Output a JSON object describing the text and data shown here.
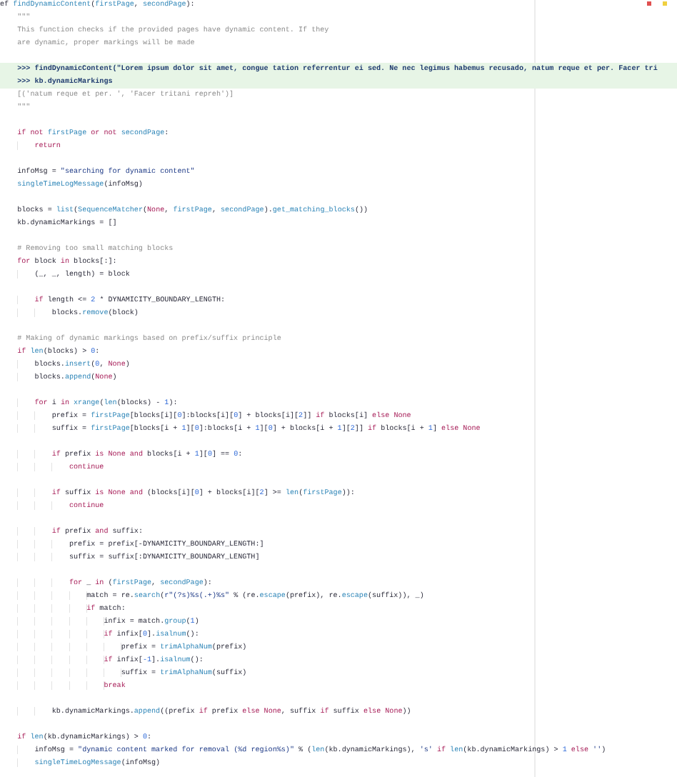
{
  "editor": {
    "blocks": [
      {
        "lines": [
          {
            "highlighted": false,
            "tokens": [
              {
                "kind": "plain",
                "text": "ef "
              },
              {
                "kind": "call",
                "text": "findDynamicContent"
              },
              {
                "kind": "plain",
                "text": "("
              },
              {
                "kind": "param",
                "text": "firstPage"
              },
              {
                "kind": "plain",
                "text": ", "
              },
              {
                "kind": "param",
                "text": "secondPage"
              },
              {
                "kind": "plain",
                "text": "):"
              }
            ]
          },
          {
            "highlighted": false,
            "tokens": [
              {
                "kind": "doc",
                "text": "    \"\"\""
              }
            ]
          },
          {
            "highlighted": false,
            "tokens": [
              {
                "kind": "doc",
                "text": "    This function checks if the provided pages have dynamic content. If they"
              }
            ]
          },
          {
            "highlighted": false,
            "tokens": [
              {
                "kind": "doc",
                "text": "    are dynamic, proper markings will be made"
              }
            ]
          }
        ]
      },
      {
        "lines": [
          {
            "highlighted": true,
            "tokens": [
              {
                "kind": "doctest",
                "text": "    >>> findDynamicContent(\"Lorem ipsum dolor sit amet, congue tation referrentur ei sed. Ne nec legimus habemus recusado, natum reque et per. Facer tri"
              }
            ]
          },
          {
            "highlighted": true,
            "tokens": [
              {
                "kind": "doctest",
                "text": "    >>> kb.dynamicMarkings"
              }
            ]
          },
          {
            "highlighted": false,
            "tokens": [
              {
                "kind": "doc",
                "text": "    [('natum reque et per. ', 'Facer tritani repreh')]"
              }
            ]
          },
          {
            "highlighted": false,
            "tokens": [
              {
                "kind": "doc",
                "text": "    \"\"\""
              }
            ]
          }
        ]
      },
      {
        "lines": [
          {
            "highlighted": false,
            "tokens": [
              {
                "kind": "keyword",
                "text": "    if"
              },
              {
                "kind": "keyword",
                "text": " not"
              },
              {
                "kind": "param",
                "text": " firstPage"
              },
              {
                "kind": "keyword",
                "text": " or"
              },
              {
                "kind": "keyword",
                "text": " not"
              },
              {
                "kind": "param",
                "text": " secondPage"
              },
              {
                "kind": "plain",
                "text": ":"
              }
            ]
          },
          {
            "highlighted": false,
            "tokens": [
              {
                "kind": "keyword",
                "text": "        return"
              }
            ]
          }
        ]
      },
      {
        "lines": [
          {
            "highlighted": false,
            "tokens": [
              {
                "kind": "plain",
                "text": "    infoMsg = "
              },
              {
                "kind": "string",
                "text": "\"searching for dynamic content\""
              }
            ]
          },
          {
            "highlighted": false,
            "tokens": [
              {
                "kind": "call",
                "text": "    singleTimeLogMessage"
              },
              {
                "kind": "plain",
                "text": "(infoMsg)"
              }
            ]
          }
        ]
      },
      {
        "lines": [
          {
            "highlighted": false,
            "tokens": [
              {
                "kind": "plain",
                "text": "    blocks = "
              },
              {
                "kind": "call",
                "text": "list"
              },
              {
                "kind": "plain",
                "text": "("
              },
              {
                "kind": "call",
                "text": "SequenceMatcher"
              },
              {
                "kind": "plain",
                "text": "("
              },
              {
                "kind": "constant",
                "text": "None"
              },
              {
                "kind": "plain",
                "text": ", "
              },
              {
                "kind": "param",
                "text": "firstPage"
              },
              {
                "kind": "plain",
                "text": ", "
              },
              {
                "kind": "param",
                "text": "secondPage"
              },
              {
                "kind": "plain",
                "text": ")."
              },
              {
                "kind": "call",
                "text": "get_matching_blocks"
              },
              {
                "kind": "plain",
                "text": "())"
              }
            ]
          },
          {
            "highlighted": false,
            "tokens": [
              {
                "kind": "plain",
                "text": "    kb.dynamicMarkings = []"
              }
            ]
          }
        ]
      },
      {
        "lines": [
          {
            "highlighted": false,
            "tokens": [
              {
                "kind": "comment",
                "text": "    # Removing too small matching blocks"
              }
            ]
          },
          {
            "highlighted": false,
            "tokens": [
              {
                "kind": "keyword",
                "text": "    for"
              },
              {
                "kind": "plain",
                "text": " block "
              },
              {
                "kind": "keyword",
                "text": "in"
              },
              {
                "kind": "plain",
                "text": " blocks[:]:"
              }
            ]
          },
          {
            "highlighted": false,
            "tokens": [
              {
                "kind": "plain",
                "text": "        (_, _, length) = block"
              }
            ]
          }
        ]
      },
      {
        "lines": [
          {
            "highlighted": false,
            "tokens": [
              {
                "kind": "keyword",
                "text": "        if"
              },
              {
                "kind": "plain",
                "text": " length <= "
              },
              {
                "kind": "number",
                "text": "2"
              },
              {
                "kind": "plain",
                "text": " * DYNAMICITY_BOUNDARY_LENGTH:"
              }
            ]
          },
          {
            "highlighted": false,
            "tokens": [
              {
                "kind": "plain",
                "text": "            blocks."
              },
              {
                "kind": "call",
                "text": "remove"
              },
              {
                "kind": "plain",
                "text": "(block)"
              }
            ]
          }
        ]
      },
      {
        "lines": [
          {
            "highlighted": false,
            "tokens": [
              {
                "kind": "comment",
                "text": "    # Making of dynamic markings based on prefix/suffix principle"
              }
            ]
          },
          {
            "highlighted": false,
            "tokens": [
              {
                "kind": "keyword",
                "text": "    if"
              },
              {
                "kind": "call",
                "text": " len"
              },
              {
                "kind": "plain",
                "text": "(blocks) > "
              },
              {
                "kind": "number",
                "text": "0"
              },
              {
                "kind": "plain",
                "text": ":"
              }
            ]
          },
          {
            "highlighted": false,
            "tokens": [
              {
                "kind": "plain",
                "text": "        blocks."
              },
              {
                "kind": "call",
                "text": "insert"
              },
              {
                "kind": "plain",
                "text": "("
              },
              {
                "kind": "number",
                "text": "0"
              },
              {
                "kind": "plain",
                "text": ", "
              },
              {
                "kind": "constant",
                "text": "None"
              },
              {
                "kind": "plain",
                "text": ")"
              }
            ]
          },
          {
            "highlighted": false,
            "tokens": [
              {
                "kind": "plain",
                "text": "        blocks."
              },
              {
                "kind": "call",
                "text": "append"
              },
              {
                "kind": "plain",
                "text": "("
              },
              {
                "kind": "constant",
                "text": "None"
              },
              {
                "kind": "plain",
                "text": ")"
              }
            ]
          }
        ]
      },
      {
        "lines": [
          {
            "highlighted": false,
            "tokens": [
              {
                "kind": "keyword",
                "text": "        for"
              },
              {
                "kind": "plain",
                "text": " i "
              },
              {
                "kind": "keyword",
                "text": "in"
              },
              {
                "kind": "call",
                "text": " xrange"
              },
              {
                "kind": "plain",
                "text": "("
              },
              {
                "kind": "call",
                "text": "len"
              },
              {
                "kind": "plain",
                "text": "(blocks) - "
              },
              {
                "kind": "number",
                "text": "1"
              },
              {
                "kind": "plain",
                "text": "):"
              }
            ]
          },
          {
            "highlighted": false,
            "tokens": [
              {
                "kind": "plain",
                "text": "            prefix = "
              },
              {
                "kind": "param",
                "text": "firstPage"
              },
              {
                "kind": "plain",
                "text": "[blocks[i]["
              },
              {
                "kind": "number",
                "text": "0"
              },
              {
                "kind": "plain",
                "text": "]:blocks[i]["
              },
              {
                "kind": "number",
                "text": "0"
              },
              {
                "kind": "plain",
                "text": "] + blocks[i]["
              },
              {
                "kind": "number",
                "text": "2"
              },
              {
                "kind": "plain",
                "text": "]] "
              },
              {
                "kind": "keyword",
                "text": "if"
              },
              {
                "kind": "plain",
                "text": " blocks[i] "
              },
              {
                "kind": "keyword",
                "text": "else"
              },
              {
                "kind": "constant",
                "text": " None"
              }
            ]
          },
          {
            "highlighted": false,
            "tokens": [
              {
                "kind": "plain",
                "text": "            suffix = "
              },
              {
                "kind": "param",
                "text": "firstPage"
              },
              {
                "kind": "plain",
                "text": "[blocks[i + "
              },
              {
                "kind": "number",
                "text": "1"
              },
              {
                "kind": "plain",
                "text": "]["
              },
              {
                "kind": "number",
                "text": "0"
              },
              {
                "kind": "plain",
                "text": "]:blocks[i + "
              },
              {
                "kind": "number",
                "text": "1"
              },
              {
                "kind": "plain",
                "text": "]["
              },
              {
                "kind": "number",
                "text": "0"
              },
              {
                "kind": "plain",
                "text": "] + blocks[i + "
              },
              {
                "kind": "number",
                "text": "1"
              },
              {
                "kind": "plain",
                "text": "]["
              },
              {
                "kind": "number",
                "text": "2"
              },
              {
                "kind": "plain",
                "text": "]] "
              },
              {
                "kind": "keyword",
                "text": "if"
              },
              {
                "kind": "plain",
                "text": " blocks[i + "
              },
              {
                "kind": "number",
                "text": "1"
              },
              {
                "kind": "plain",
                "text": "] "
              },
              {
                "kind": "keyword",
                "text": "else"
              },
              {
                "kind": "constant",
                "text": " None"
              }
            ]
          }
        ]
      },
      {
        "lines": [
          {
            "highlighted": false,
            "tokens": [
              {
                "kind": "keyword",
                "text": "            if"
              },
              {
                "kind": "plain",
                "text": " prefix "
              },
              {
                "kind": "keyword",
                "text": "is"
              },
              {
                "kind": "constant",
                "text": " None"
              },
              {
                "kind": "keyword",
                "text": " and"
              },
              {
                "kind": "plain",
                "text": " blocks[i + "
              },
              {
                "kind": "number",
                "text": "1"
              },
              {
                "kind": "plain",
                "text": "]["
              },
              {
                "kind": "number",
                "text": "0"
              },
              {
                "kind": "plain",
                "text": "] == "
              },
              {
                "kind": "number",
                "text": "0"
              },
              {
                "kind": "plain",
                "text": ":"
              }
            ]
          },
          {
            "highlighted": false,
            "tokens": [
              {
                "kind": "keyword",
                "text": "                continue"
              }
            ]
          }
        ]
      },
      {
        "lines": [
          {
            "highlighted": false,
            "tokens": [
              {
                "kind": "keyword",
                "text": "            if"
              },
              {
                "kind": "plain",
                "text": " suffix "
              },
              {
                "kind": "keyword",
                "text": "is"
              },
              {
                "kind": "constant",
                "text": " None"
              },
              {
                "kind": "keyword",
                "text": " and"
              },
              {
                "kind": "plain",
                "text": " (blocks[i]["
              },
              {
                "kind": "number",
                "text": "0"
              },
              {
                "kind": "plain",
                "text": "] + blocks[i]["
              },
              {
                "kind": "number",
                "text": "2"
              },
              {
                "kind": "plain",
                "text": "] >= "
              },
              {
                "kind": "call",
                "text": "len"
              },
              {
                "kind": "plain",
                "text": "("
              },
              {
                "kind": "param",
                "text": "firstPage"
              },
              {
                "kind": "plain",
                "text": ")):"
              }
            ]
          },
          {
            "highlighted": false,
            "tokens": [
              {
                "kind": "keyword",
                "text": "                continue"
              }
            ]
          }
        ]
      },
      {
        "lines": [
          {
            "highlighted": false,
            "tokens": [
              {
                "kind": "keyword",
                "text": "            if"
              },
              {
                "kind": "plain",
                "text": " prefix "
              },
              {
                "kind": "keyword",
                "text": "and"
              },
              {
                "kind": "plain",
                "text": " suffix:"
              }
            ]
          },
          {
            "highlighted": false,
            "tokens": [
              {
                "kind": "plain",
                "text": "                prefix = prefix[-DYNAMICITY_BOUNDARY_LENGTH:]"
              }
            ]
          },
          {
            "highlighted": false,
            "tokens": [
              {
                "kind": "plain",
                "text": "                suffix = suffix[:DYNAMICITY_BOUNDARY_LENGTH]"
              }
            ]
          }
        ]
      },
      {
        "lines": [
          {
            "highlighted": false,
            "tokens": [
              {
                "kind": "keyword",
                "text": "                for"
              },
              {
                "kind": "plain",
                "text": " _ "
              },
              {
                "kind": "keyword",
                "text": "in"
              },
              {
                "kind": "plain",
                "text": " ("
              },
              {
                "kind": "param",
                "text": "firstPage"
              },
              {
                "kind": "plain",
                "text": ", "
              },
              {
                "kind": "param",
                "text": "secondPage"
              },
              {
                "kind": "plain",
                "text": "):"
              }
            ]
          },
          {
            "highlighted": false,
            "tokens": [
              {
                "kind": "plain",
                "text": "                    match = re."
              },
              {
                "kind": "call",
                "text": "search"
              },
              {
                "kind": "plain",
                "text": "("
              },
              {
                "kind": "string",
                "text": "r\"(?s)%s(.+)%s\""
              },
              {
                "kind": "plain",
                "text": " % (re."
              },
              {
                "kind": "call",
                "text": "escape"
              },
              {
                "kind": "plain",
                "text": "(prefix), re."
              },
              {
                "kind": "call",
                "text": "escape"
              },
              {
                "kind": "plain",
                "text": "(suffix)), _)"
              }
            ]
          },
          {
            "highlighted": false,
            "tokens": [
              {
                "kind": "keyword",
                "text": "                    if"
              },
              {
                "kind": "plain",
                "text": " match:"
              }
            ]
          },
          {
            "highlighted": false,
            "tokens": [
              {
                "kind": "plain",
                "text": "                        infix = match."
              },
              {
                "kind": "call",
                "text": "group"
              },
              {
                "kind": "plain",
                "text": "("
              },
              {
                "kind": "number",
                "text": "1"
              },
              {
                "kind": "plain",
                "text": ")"
              }
            ]
          },
          {
            "highlighted": false,
            "tokens": [
              {
                "kind": "keyword",
                "text": "                        if"
              },
              {
                "kind": "plain",
                "text": " infix["
              },
              {
                "kind": "number",
                "text": "0"
              },
              {
                "kind": "plain",
                "text": "]."
              },
              {
                "kind": "call",
                "text": "isalnum"
              },
              {
                "kind": "plain",
                "text": "():"
              }
            ]
          },
          {
            "highlighted": false,
            "tokens": [
              {
                "kind": "plain",
                "text": "                            prefix = "
              },
              {
                "kind": "call",
                "text": "trimAlphaNum"
              },
              {
                "kind": "plain",
                "text": "(prefix)"
              }
            ]
          },
          {
            "highlighted": false,
            "tokens": [
              {
                "kind": "keyword",
                "text": "                        if"
              },
              {
                "kind": "plain",
                "text": " infix["
              },
              {
                "kind": "number",
                "text": "-1"
              },
              {
                "kind": "plain",
                "text": "]."
              },
              {
                "kind": "call",
                "text": "isalnum"
              },
              {
                "kind": "plain",
                "text": "():"
              }
            ]
          },
          {
            "highlighted": false,
            "tokens": [
              {
                "kind": "plain",
                "text": "                            suffix = "
              },
              {
                "kind": "call",
                "text": "trimAlphaNum"
              },
              {
                "kind": "plain",
                "text": "(suffix)"
              }
            ]
          },
          {
            "highlighted": false,
            "tokens": [
              {
                "kind": "keyword",
                "text": "                        break"
              }
            ]
          }
        ]
      },
      {
        "lines": [
          {
            "highlighted": false,
            "tokens": [
              {
                "kind": "plain",
                "text": "            kb.dynamicMarkings."
              },
              {
                "kind": "call",
                "text": "append"
              },
              {
                "kind": "plain",
                "text": "((prefix "
              },
              {
                "kind": "keyword",
                "text": "if"
              },
              {
                "kind": "plain",
                "text": " prefix "
              },
              {
                "kind": "keyword",
                "text": "else"
              },
              {
                "kind": "constant",
                "text": " None"
              },
              {
                "kind": "plain",
                "text": ", suffix "
              },
              {
                "kind": "keyword",
                "text": "if"
              },
              {
                "kind": "plain",
                "text": " suffix "
              },
              {
                "kind": "keyword",
                "text": "else"
              },
              {
                "kind": "constant",
                "text": " None"
              },
              {
                "kind": "plain",
                "text": "))"
              }
            ]
          }
        ]
      },
      {
        "lines": [
          {
            "highlighted": false,
            "tokens": [
              {
                "kind": "keyword",
                "text": "    if"
              },
              {
                "kind": "call",
                "text": " len"
              },
              {
                "kind": "plain",
                "text": "(kb.dynamicMarkings) > "
              },
              {
                "kind": "number",
                "text": "0"
              },
              {
                "kind": "plain",
                "text": ":"
              }
            ]
          },
          {
            "highlighted": false,
            "tokens": [
              {
                "kind": "plain",
                "text": "        infoMsg = "
              },
              {
                "kind": "string",
                "text": "\"dynamic content marked for removal (%d region%s)\""
              },
              {
                "kind": "plain",
                "text": " % ("
              },
              {
                "kind": "call",
                "text": "len"
              },
              {
                "kind": "plain",
                "text": "(kb.dynamicMarkings), "
              },
              {
                "kind": "string",
                "text": "'s'"
              },
              {
                "kind": "keyword",
                "text": " if"
              },
              {
                "kind": "call",
                "text": " len"
              },
              {
                "kind": "plain",
                "text": "(kb.dynamicMarkings) > "
              },
              {
                "kind": "number",
                "text": "1"
              },
              {
                "kind": "keyword",
                "text": " else"
              },
              {
                "kind": "string",
                "text": " ''"
              },
              {
                "kind": "plain",
                "text": ")"
              }
            ]
          },
          {
            "highlighted": false,
            "tokens": [
              {
                "kind": "call",
                "text": "        singleTimeLogMessage"
              },
              {
                "kind": "plain",
                "text": "(infoMsg)"
              }
            ]
          }
        ]
      }
    ]
  }
}
